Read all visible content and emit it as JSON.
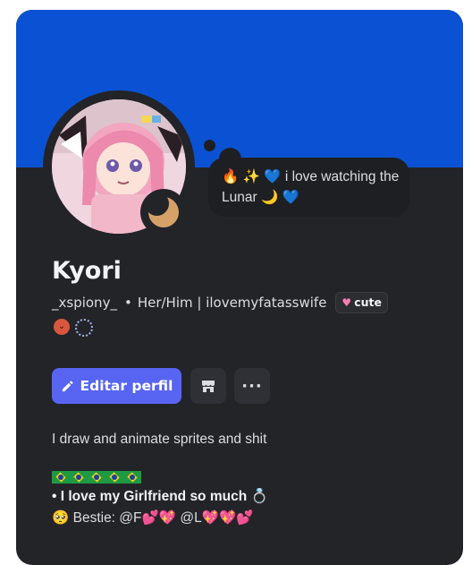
{
  "profile": {
    "display_name": "Kyori",
    "username": "_xspiony_",
    "separator": "•",
    "pronouns": "Her/Him | ilovemyfatasswife",
    "tag_label": "cute",
    "status_bubble": "🔥 ✨ 💙 i love watching the Lunar 🌙 💙",
    "status_icon": "crescent-moon-icon",
    "accent_color": "#0a52d3"
  },
  "actions": {
    "edit_label": "Editar perfil",
    "more_label": "···"
  },
  "bio": {
    "line1": "I draw and animate sprites and shit",
    "flags": "🇧🇷🇧🇷🇧🇷🇧🇷🇧🇷",
    "line2": "• I love my Girlfriend so much 💍",
    "line3": "🥺 Bestie: @F💕💖 @L💖💖💕"
  }
}
